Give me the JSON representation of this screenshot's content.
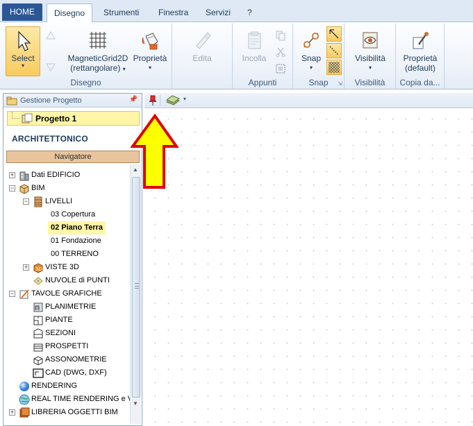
{
  "tabs": [
    {
      "label": "HOME",
      "active": false
    },
    {
      "label": "Disegno",
      "active": true
    },
    {
      "label": "Strumenti",
      "active": false
    },
    {
      "label": "Finestra",
      "active": false
    },
    {
      "label": "Servizi",
      "active": false
    },
    {
      "label": "?",
      "active": false
    }
  ],
  "ribbon": {
    "disegno": {
      "label": "Disegno",
      "select": "Select",
      "grid_line1": "MagneticGrid2D",
      "grid_line2": "(rettangolare)",
      "proprieta": "Proprietà",
      "edita": "Edita"
    },
    "appunti": {
      "label": "Appunti",
      "incolla": "Incolla"
    },
    "snap": {
      "label": "Snap",
      "snap": "Snap"
    },
    "visibilita": {
      "label": "Visibilità",
      "visibilita": "Visibilità"
    },
    "copia": {
      "label": "Copia da...",
      "line1": "Proprietà",
      "line2": "(default)"
    }
  },
  "panel": {
    "title": "Gestione Progetto",
    "project": "Progetto 1",
    "section": "ARCHITETTONICO",
    "navigator": "Navigatore"
  },
  "tree": [
    {
      "label": "Dati EDIFICIO",
      "level": 0,
      "expander": "+",
      "icon": "building-icon"
    },
    {
      "label": "BIM",
      "level": 0,
      "expander": "-",
      "icon": "cube-icon"
    },
    {
      "label": "LIVELLI",
      "level": 1,
      "expander": "-",
      "icon": "levels-icon"
    },
    {
      "label": "03 Copertura",
      "level": 2,
      "expander": "",
      "icon": ""
    },
    {
      "label": "02 Piano Terra",
      "level": 2,
      "expander": "",
      "icon": "",
      "selected": true
    },
    {
      "label": "01 Fondazione",
      "level": 2,
      "expander": "",
      "icon": ""
    },
    {
      "label": "00 TERRENO",
      "level": 2,
      "expander": "",
      "icon": ""
    },
    {
      "label": "VISTE 3D",
      "level": 1,
      "expander": "+",
      "icon": "view3d-icon"
    },
    {
      "label": "NUVOLE di PUNTI",
      "level": 1,
      "expander": "",
      "icon": "pointcloud-icon"
    },
    {
      "label": "TAVOLE GRAFICHE",
      "level": 0,
      "expander": "-",
      "icon": "drawing-icon"
    },
    {
      "label": "PLANIMETRIE",
      "level": 1,
      "expander": "",
      "icon": "plan-icon"
    },
    {
      "label": "PIANTE",
      "level": 1,
      "expander": "",
      "icon": "floorplan-icon"
    },
    {
      "label": "SEZIONI",
      "level": 1,
      "expander": "",
      "icon": "section-icon"
    },
    {
      "label": "PROSPETTI",
      "level": 1,
      "expander": "",
      "icon": "elevation-icon"
    },
    {
      "label": "ASSONOMETRIE",
      "level": 1,
      "expander": "",
      "icon": "axonometric-icon"
    },
    {
      "label": "CAD (DWG, DXF)",
      "level": 1,
      "expander": "",
      "icon": "cad-icon"
    },
    {
      "label": "RENDERING",
      "level": 0,
      "expander": "",
      "icon": "sphere-icon"
    },
    {
      "label": "REAL TIME RENDERING e VR",
      "level": 0,
      "expander": "",
      "icon": "globe-icon"
    },
    {
      "label": "LIBRERIA OGGETTI BIM",
      "level": 0,
      "expander": "+",
      "icon": "library-icon"
    }
  ],
  "colors": {
    "accent": "#2b5797",
    "selection": "#fff6a8",
    "navigator": "#e8c59d",
    "arrow_fill": "#ffff00",
    "arrow_stroke": "#e00000"
  }
}
